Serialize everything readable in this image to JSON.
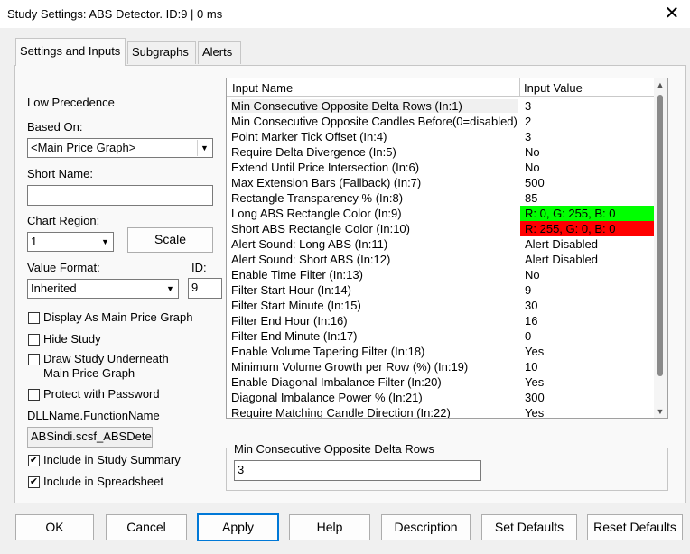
{
  "window": {
    "title": "Study Settings: ABS Detector. ID:9 | 0 ms",
    "close_glyph": "✕"
  },
  "tabs": [
    {
      "label": "Settings and Inputs"
    },
    {
      "label": "Subgraphs"
    },
    {
      "label": "Alerts"
    }
  ],
  "left": {
    "precedence": "Low Precedence",
    "based_on_label": "Based On:",
    "based_on_value": "<Main Price Graph>",
    "short_name_label": "Short Name:",
    "short_name_value": "",
    "chart_region_label": "Chart Region:",
    "chart_region_value": "1",
    "scale_button": "Scale",
    "value_format_label": "Value Format:",
    "value_format_value": "Inherited",
    "id_label": "ID:",
    "id_value": "9",
    "display_as_main": "Display As Main Price Graph",
    "hide_study": "Hide Study",
    "draw_underneath_1": "Draw Study Underneath",
    "draw_underneath_2": "Main Price Graph",
    "protect_password": "Protect with Password",
    "dll_label": "DLLName.FunctionName",
    "dll_value": "ABSindi.scsf_ABSDete",
    "include_summary": "Include in Study Summary",
    "include_spreadsheet": "Include in Spreadsheet",
    "check_glyph": "✔"
  },
  "grid": {
    "col_name": "Input Name",
    "col_value": "Input Value",
    "rows": [
      {
        "name": "Min Consecutive Opposite Delta Rows  (In:1)",
        "value": "3"
      },
      {
        "name": "Min Consecutive Opposite Candles Before(0=disabled)",
        "value": "2"
      },
      {
        "name": "Point Marker Tick Offset  (In:4)",
        "value": "3"
      },
      {
        "name": "Require Delta Divergence  (In:5)",
        "value": "No"
      },
      {
        "name": "Extend Until Price Intersection  (In:6)",
        "value": "No"
      },
      {
        "name": "Max Extension Bars (Fallback)  (In:7)",
        "value": "500"
      },
      {
        "name": "Rectangle Transparency %  (In:8)",
        "value": "85"
      },
      {
        "name": "Long ABS Rectangle Color  (In:9)",
        "value": "R: 0, G: 255, B: 0"
      },
      {
        "name": "Short ABS Rectangle Color  (In:10)",
        "value": "R: 255, G: 0, B: 0"
      },
      {
        "name": "Alert Sound: Long ABS  (In:11)",
        "value": "Alert Disabled"
      },
      {
        "name": "Alert Sound: Short ABS  (In:12)",
        "value": "Alert Disabled"
      },
      {
        "name": "Enable Time Filter  (In:13)",
        "value": "No"
      },
      {
        "name": "Filter Start Hour  (In:14)",
        "value": "9"
      },
      {
        "name": "Filter Start Minute  (In:15)",
        "value": "30"
      },
      {
        "name": "Filter End Hour  (In:16)",
        "value": "16"
      },
      {
        "name": "Filter End Minute  (In:17)",
        "value": "0"
      },
      {
        "name": "Enable Volume Tapering Filter  (In:18)",
        "value": "Yes"
      },
      {
        "name": "Minimum Volume Growth per Row (%)  (In:19)",
        "value": "10"
      },
      {
        "name": "Enable Diagonal Imbalance Filter  (In:20)",
        "value": "Yes"
      },
      {
        "name": "Diagonal Imbalance Power %  (In:21)",
        "value": "300"
      },
      {
        "name": "Require Matching Candle Direction  (In:22)",
        "value": "Yes"
      }
    ],
    "color_swatches": {
      "long": "#00ff00",
      "short": "#ff0000"
    }
  },
  "edit": {
    "label": "Min Consecutive Opposite Delta Rows",
    "value": "3"
  },
  "buttons": {
    "ok": "OK",
    "cancel": "Cancel",
    "apply": "Apply",
    "help": "Help",
    "description": "Description",
    "set_defaults": "Set Defaults",
    "reset_defaults": "Reset Defaults"
  }
}
